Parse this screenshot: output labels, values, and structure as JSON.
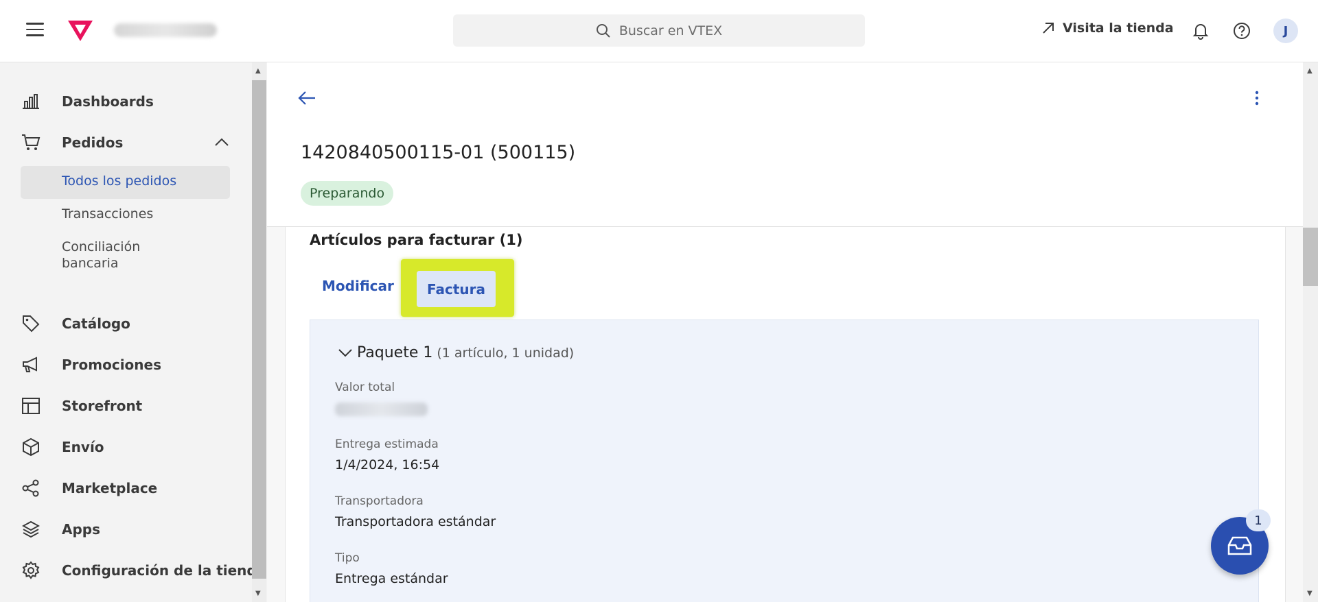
{
  "header": {
    "search_placeholder": "Buscar en VTEX",
    "visit_store": "Visita la tienda",
    "avatar_initial": "J"
  },
  "sidebar": {
    "items": [
      {
        "label": "Dashboards",
        "icon": "bar-chart-icon"
      },
      {
        "label": "Pedidos",
        "icon": "cart-icon"
      },
      {
        "label": "Catálogo",
        "icon": "tag-icon"
      },
      {
        "label": "Promociones",
        "icon": "megaphone-icon"
      },
      {
        "label": "Storefront",
        "icon": "layout-icon"
      },
      {
        "label": "Envío",
        "icon": "box-icon"
      },
      {
        "label": "Marketplace",
        "icon": "share-icon"
      },
      {
        "label": "Apps",
        "icon": "layers-icon"
      },
      {
        "label": "Configuración de la tienda",
        "icon": "gear-icon"
      }
    ],
    "subitems": [
      {
        "label": "Todos los pedidos"
      },
      {
        "label": "Transacciones"
      },
      {
        "label": "Conciliación"
      },
      {
        "label": "bancaria"
      }
    ]
  },
  "order": {
    "title": "1420840500115-01 (500115)",
    "status": "Preparando"
  },
  "section": {
    "title": "Artículos para facturar (1)",
    "tab_modify": "Modificar",
    "tab_invoice": "Factura"
  },
  "package": {
    "title": "Paquete 1",
    "meta": "(1 artículo, 1 unidad)",
    "fields": [
      {
        "label": "Valor total"
      },
      {
        "label": "Entrega estimada",
        "value": "1/4/2024, 16:54"
      },
      {
        "label": "Transportadora",
        "value": "Transportadora estándar"
      },
      {
        "label": "Tipo",
        "value": "Entrega estándar"
      }
    ]
  },
  "fab": {
    "badge": "1"
  },
  "colors": {
    "accent": "#2c55b3",
    "highlight": "#d7e92a",
    "status_bg": "#d9f1de",
    "logo": "#e8125c"
  }
}
